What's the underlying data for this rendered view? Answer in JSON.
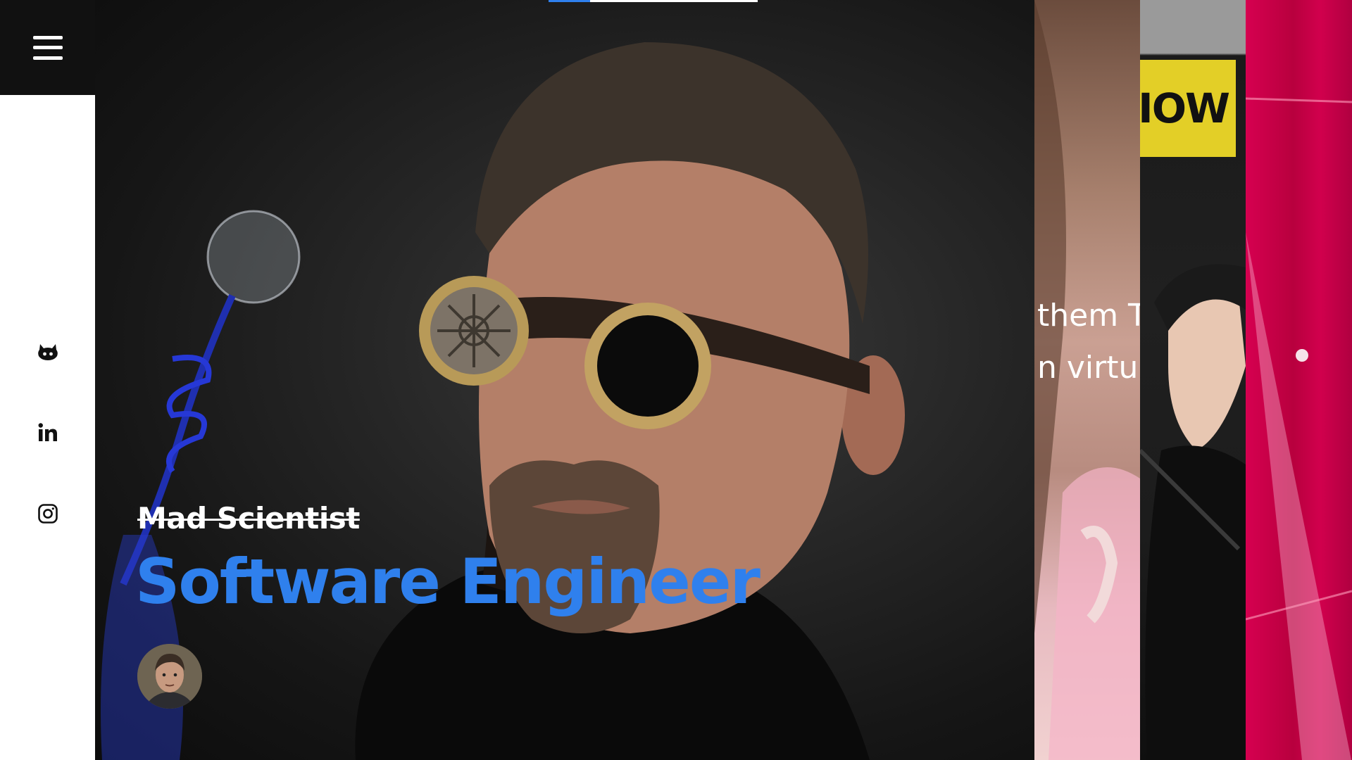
{
  "menu": {
    "icon": "hamburger-icon"
  },
  "social_links": [
    {
      "name": "github",
      "icon": "github-icon"
    },
    {
      "name": "linkedin",
      "icon": "linkedin-icon"
    },
    {
      "name": "instagram",
      "icon": "instagram-icon"
    }
  ],
  "hero": {
    "struck_title": "Mad Scientist",
    "title": "Software Engineer",
    "title_color": "#2f80ed",
    "slide_progress_fraction": 0.2
  },
  "previews": [
    {
      "visible_text_lines": [
        "them T",
        "n virtu"
      ]
    },
    {
      "visible_text": "IOW"
    },
    {
      "visible_text": ""
    }
  ],
  "colors": {
    "accent": "#2f80ed",
    "menu_bg": "#111111",
    "sidebar_bg": "#ffffff"
  }
}
